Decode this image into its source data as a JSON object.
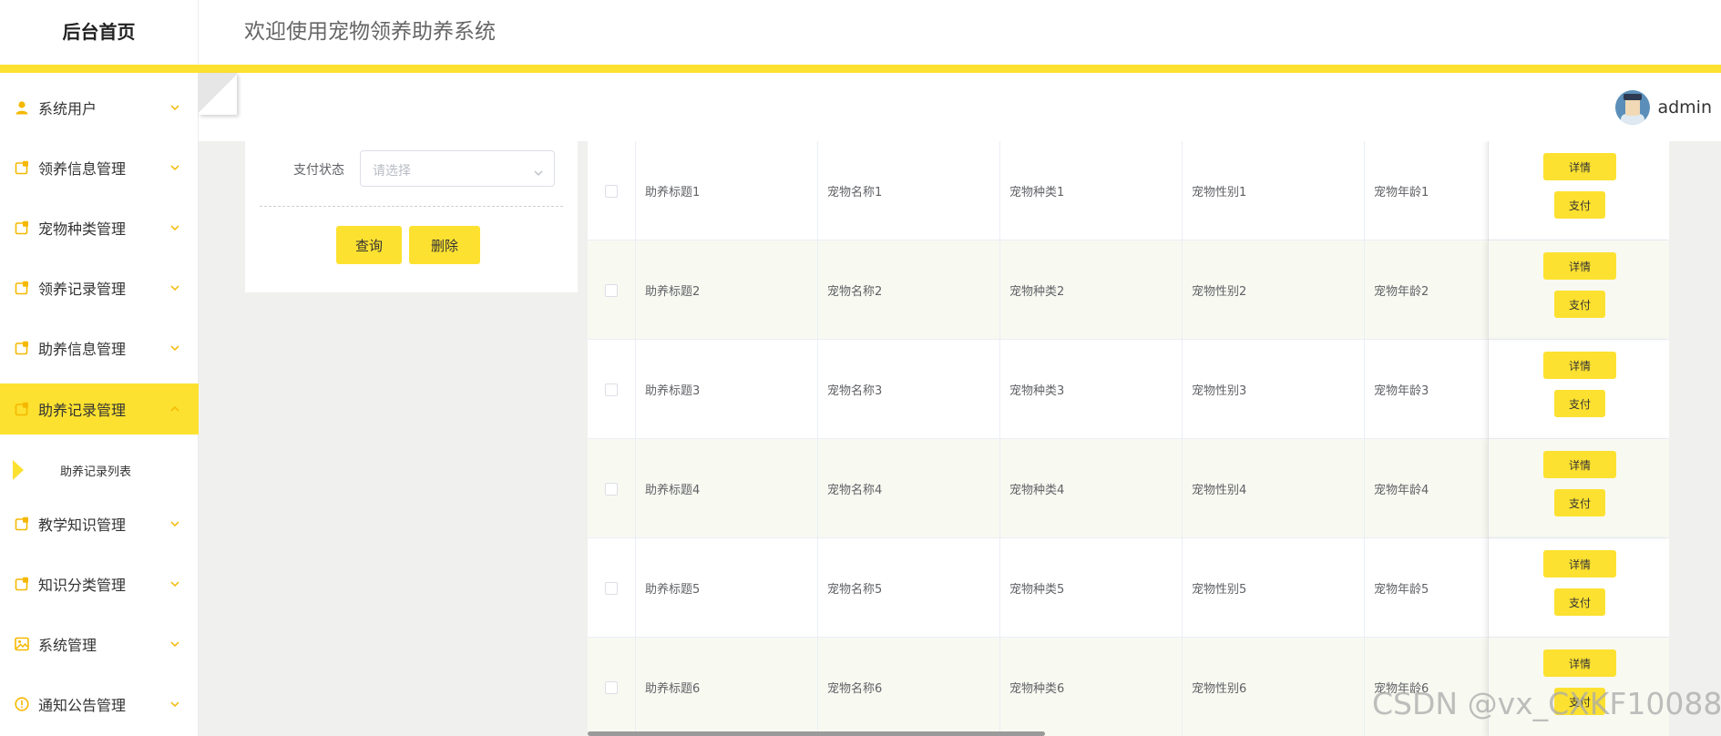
{
  "header": {
    "brand": "后台首页",
    "welcome": "欢迎使用宠物领养助养系统"
  },
  "user": {
    "name": "admin"
  },
  "sidebar": {
    "items": [
      {
        "label": "系统用户",
        "icon": "user-icon"
      },
      {
        "label": "领养信息管理",
        "icon": "folder-icon"
      },
      {
        "label": "宠物种类管理",
        "icon": "folder-icon"
      },
      {
        "label": "领养记录管理",
        "icon": "folder-icon"
      },
      {
        "label": "助养信息管理",
        "icon": "folder-icon"
      },
      {
        "label": "助养记录管理",
        "icon": "folder-icon",
        "active": true,
        "expanded": true
      },
      {
        "label": "教学知识管理",
        "icon": "folder-icon"
      },
      {
        "label": "知识分类管理",
        "icon": "folder-icon"
      },
      {
        "label": "系统管理",
        "icon": "image-icon"
      },
      {
        "label": "通知公告管理",
        "icon": "info-icon"
      }
    ],
    "submenu": {
      "label": "助养记录列表"
    }
  },
  "search": {
    "pay_status_label": "支付状态",
    "pay_status_placeholder": "请选择",
    "query_label": "查询",
    "delete_label": "删除"
  },
  "table": {
    "rows": [
      {
        "title": "助养标题1",
        "pet_name": "宠物名称1",
        "pet_type": "宠物种类1",
        "pet_gender": "宠物性别1",
        "pet_age": "宠物年龄1"
      },
      {
        "title": "助养标题2",
        "pet_name": "宠物名称2",
        "pet_type": "宠物种类2",
        "pet_gender": "宠物性别2",
        "pet_age": "宠物年龄2"
      },
      {
        "title": "助养标题3",
        "pet_name": "宠物名称3",
        "pet_type": "宠物种类3",
        "pet_gender": "宠物性别3",
        "pet_age": "宠物年龄3"
      },
      {
        "title": "助养标题4",
        "pet_name": "宠物名称4",
        "pet_type": "宠物种类4",
        "pet_gender": "宠物性别4",
        "pet_age": "宠物年龄4"
      },
      {
        "title": "助养标题5",
        "pet_name": "宠物名称5",
        "pet_type": "宠物种类5",
        "pet_gender": "宠物性别5",
        "pet_age": "宠物年龄5"
      },
      {
        "title": "助养标题6",
        "pet_name": "宠物名称6",
        "pet_type": "宠物种类6",
        "pet_gender": "宠物性别6",
        "pet_age": "宠物年龄6"
      }
    ],
    "detail_label": "详情",
    "pay_label": "支付"
  },
  "watermark": "CSDN @vx_CXKF10088",
  "colors": {
    "accent": "#fde130",
    "icon": "#f5b800",
    "row_alt": "#f8f9f1"
  }
}
